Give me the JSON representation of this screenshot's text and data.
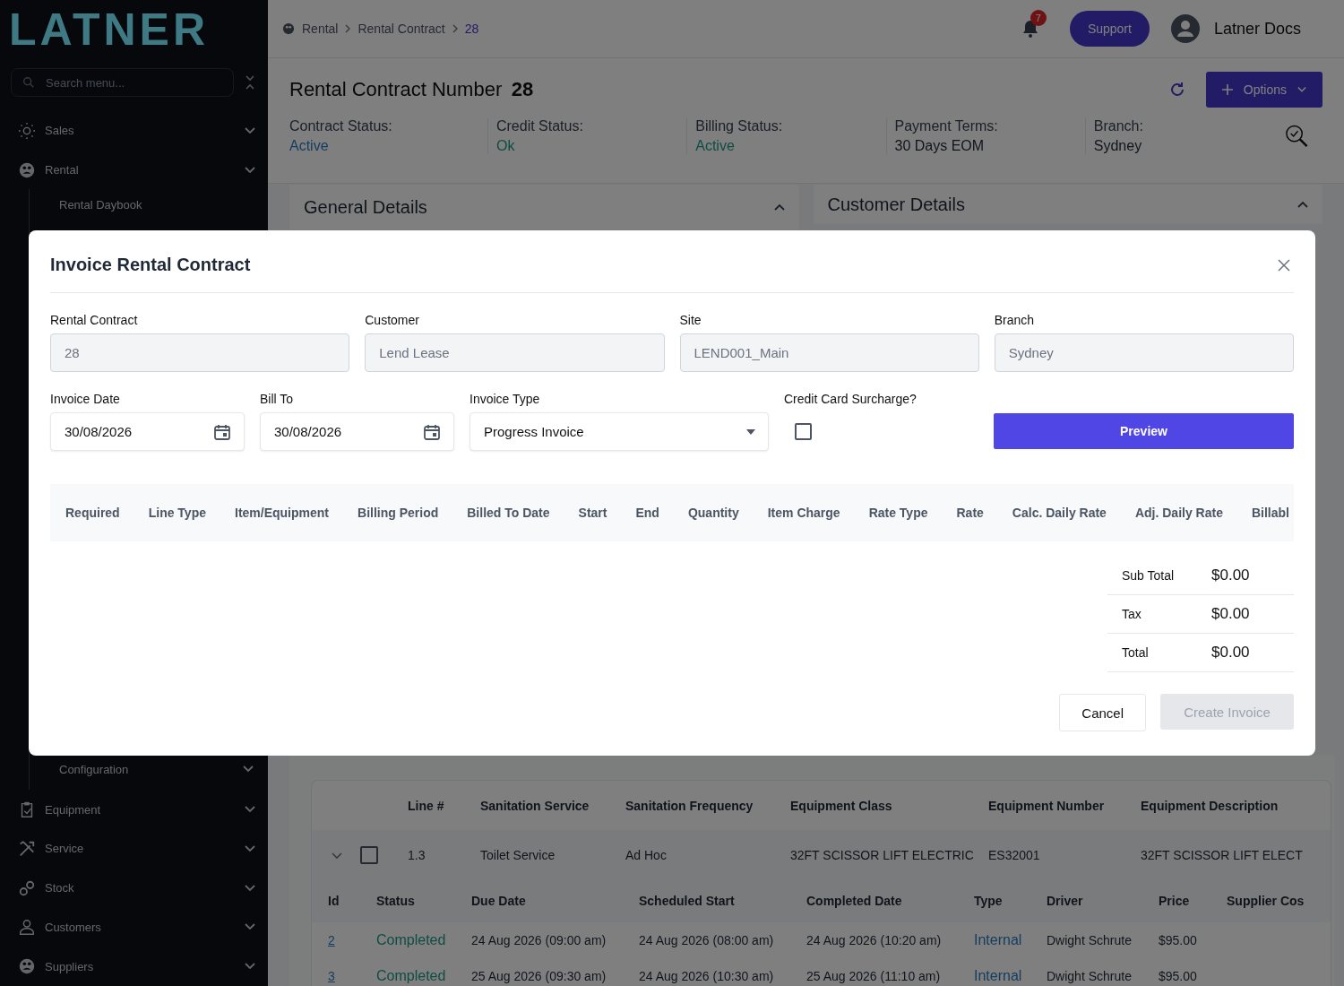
{
  "sidebar": {
    "logo": "LATNER",
    "search": {
      "placeholder": "Search menu..."
    },
    "items": [
      {
        "label": "Sales",
        "kind": "sales"
      },
      {
        "label": "Rental",
        "kind": "rental",
        "expanded": true,
        "children": [
          {
            "label": "Rental Daybook",
            "has_menu": false
          },
          {
            "label": "Configuration",
            "has_menu": true
          }
        ]
      },
      {
        "label": "Equipment",
        "kind": "equipment"
      },
      {
        "label": "Service",
        "kind": "service"
      },
      {
        "label": "Stock",
        "kind": "stock"
      },
      {
        "label": "Customers",
        "kind": "customers"
      },
      {
        "label": "Suppliers",
        "kind": "suppliers"
      }
    ]
  },
  "breadcrumb": [
    {
      "label": "Rental",
      "selected": false
    },
    {
      "label": "Rental Contract",
      "selected": false
    },
    {
      "label": "28",
      "selected": true
    }
  ],
  "header": {
    "notifications": "7",
    "support_button": "Support",
    "user": "Latner Docs"
  },
  "contract": {
    "title": "Rental Contract Number",
    "number": "28",
    "options_button": "Options",
    "statuses": [
      {
        "label": "Contract Status:",
        "value": "Active",
        "kind": "info"
      },
      {
        "label": "Credit Status:",
        "value": "Ok",
        "kind": "positive"
      },
      {
        "label": "Billing Status:",
        "value": "Active",
        "kind": "positive"
      },
      {
        "label": "Payment Terms:",
        "value": "30 Days EOM",
        "kind": "plain"
      },
      {
        "label": "Branch:",
        "value": "Sydney",
        "kind": "plain"
      }
    ]
  },
  "sections": [
    {
      "title": "General Details"
    },
    {
      "title": "Customer Details"
    }
  ],
  "dialog": {
    "title": "Invoice Rental Contract",
    "fields": [
      {
        "label": "Rental Contract",
        "value": "28",
        "disabled": true
      },
      {
        "label": "Customer",
        "value": "Lend Lease",
        "disabled": true
      },
      {
        "label": "Site",
        "value": "LEND001_Main",
        "disabled": true
      },
      {
        "label": "Branch",
        "value": "Sydney",
        "disabled": true
      }
    ],
    "invoice_fields": [
      {
        "label": "Invoice Date",
        "kind": "date",
        "value": "30/08/2026"
      },
      {
        "label": "Bill To",
        "kind": "date",
        "value": "30/08/2026"
      },
      {
        "label": "Invoice Type",
        "kind": "select",
        "value": "Progress Invoice"
      },
      {
        "label": "Credit Card Surcharge?",
        "kind": "checkbox",
        "checked": false
      }
    ],
    "preview_button": "Preview",
    "line_columns": [
      "Required",
      "Line Type",
      "Item/Equipment",
      "Billing Period",
      "Billed To Date",
      "Start",
      "End",
      "Quantity",
      "Item Charge",
      "Rate Type",
      "Rate",
      "Calc. Daily Rate",
      "Adj. Daily Rate",
      "Billabl"
    ],
    "totals": [
      {
        "label": "Sub Total",
        "value": "$0.00"
      },
      {
        "label": "Tax",
        "value": "$0.00"
      },
      {
        "label": "Total",
        "value": "$0.00"
      }
    ],
    "cancel_button": "Cancel",
    "create_button": {
      "label": "Create Invoice",
      "disabled": true
    }
  },
  "service_table": {
    "columns": [
      "Line #",
      "Sanitation Service",
      "Sanitation Frequency",
      "Equipment Class",
      "Equipment Number",
      "Equipment Description"
    ],
    "rows": [
      {
        "expanded": true,
        "checked": false,
        "cells": [
          "1.3",
          "Toilet Service",
          "Ad Hoc",
          "32FT SCISSOR LIFT ELECTRIC",
          "ES32001",
          "32FT SCISSOR LIFT ELECT"
        ]
      }
    ],
    "sub_columns": [
      {
        "label": "Id",
        "kind": "link"
      },
      {
        "label": "Status",
        "kind": "status"
      },
      {
        "label": "Due Date",
        "kind": "text"
      },
      {
        "label": "Scheduled Start",
        "kind": "text"
      },
      {
        "label": "Completed Date",
        "kind": "text"
      },
      {
        "label": "Type",
        "kind": "type"
      },
      {
        "label": "Driver",
        "kind": "text"
      },
      {
        "label": "Price",
        "kind": "text"
      },
      {
        "label": "Supplier Cos"
      }
    ],
    "sub_rows": [
      [
        "2",
        "Completed",
        "24 Aug 2026 (09:00 am)",
        "24 Aug 2026 (08:00 am)",
        "24 Aug 2026 (10:20 am)",
        "Internal",
        "Dwight Schrute",
        "$95.00"
      ],
      [
        "3",
        "Completed",
        "25 Aug 2026 (09:30 am)",
        "24 Aug 2026 (10:30 am)",
        "25 Aug 2026 (11:10 am)",
        "Internal",
        "Dwight Schrute",
        "$95.00"
      ]
    ]
  }
}
